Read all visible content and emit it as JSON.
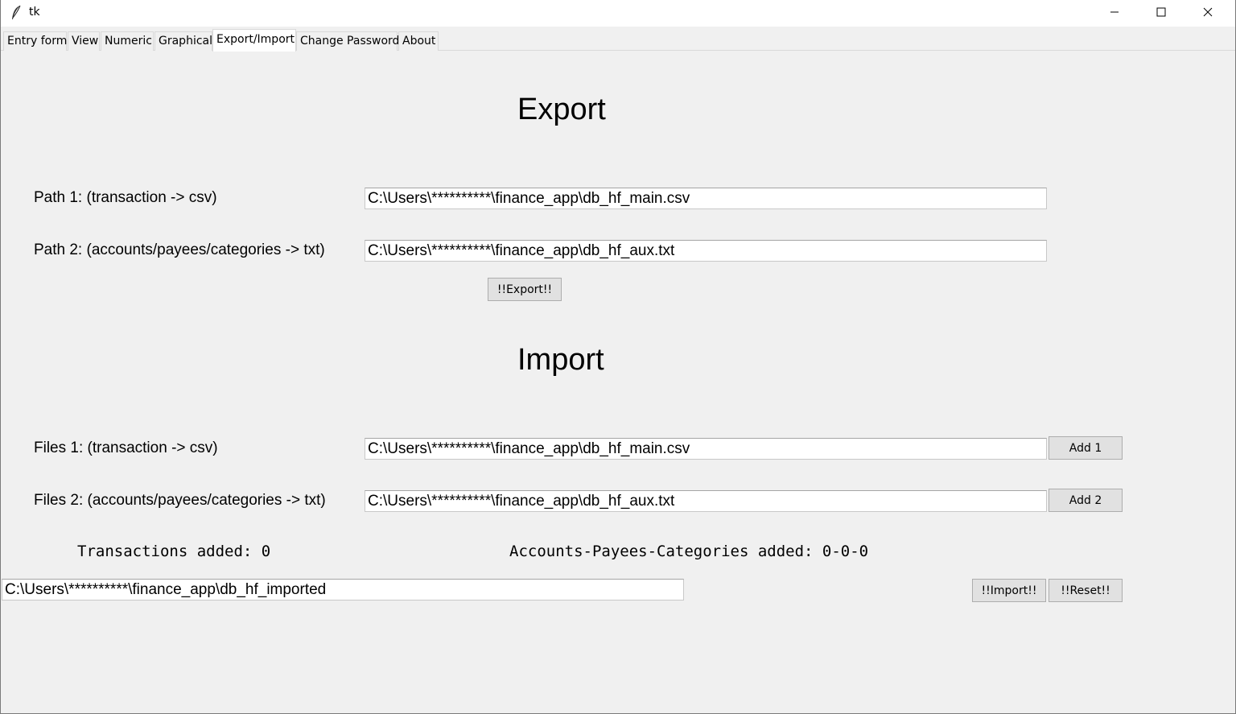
{
  "window": {
    "title": "tk",
    "controls": {
      "minimize": "minimize-icon",
      "maximize": "maximize-icon",
      "close": "close-icon"
    }
  },
  "tabs": [
    {
      "label": "Entry form"
    },
    {
      "label": "View"
    },
    {
      "label": "Numeric"
    },
    {
      "label": "Graphical"
    },
    {
      "label": "Export/Import",
      "active": true
    },
    {
      "label": "Change Password"
    },
    {
      "label": "About"
    }
  ],
  "export": {
    "heading": "Export",
    "path1_label": "Path 1: (transaction -> csv)",
    "path1_value": "C:\\Users\\**********\\finance_app\\db_hf_main.csv",
    "path2_label": "Path 2: (accounts/payees/categories -> txt)",
    "path2_value": "C:\\Users\\**********\\finance_app\\db_hf_aux.txt",
    "export_button": "!!Export!!"
  },
  "import": {
    "heading": "Import",
    "files1_label": "Files 1: (transaction -> csv)",
    "files1_value": "C:\\Users\\**********\\finance_app\\db_hf_main.csv",
    "add1_button": "Add 1",
    "files2_label": "Files 2: (accounts/payees/categories -> txt)",
    "files2_value": "C:\\Users\\**********\\finance_app\\db_hf_aux.txt",
    "add2_button": "Add 2",
    "transactions_added": "Transactions added: 0",
    "apc_added": "Accounts-Payees-Categories added: 0-0-0",
    "output_path": "C:\\Users\\**********\\finance_app\\db_hf_imported",
    "import_button": "!!Import!!",
    "reset_button": "!!Reset!!"
  }
}
